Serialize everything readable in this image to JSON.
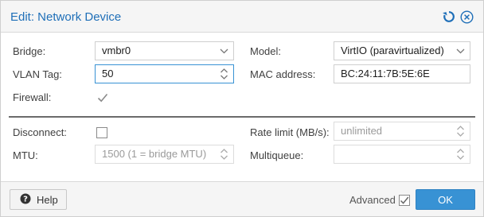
{
  "dialog": {
    "title": "Edit: Network Device",
    "accent_color": "#1f6fb8",
    "tools": {
      "reset_icon": "reset-icon",
      "close_icon": "close-icon"
    }
  },
  "form": {
    "bridge": {
      "label": "Bridge:",
      "value": "vmbr0"
    },
    "vlan_tag": {
      "label": "VLAN Tag:",
      "value": "50"
    },
    "firewall": {
      "label": "Firewall:",
      "checked": true
    },
    "model": {
      "label": "Model:",
      "value": "VirtIO (paravirtualized)"
    },
    "mac_address": {
      "label": "MAC address:",
      "value": "BC:24:11:7B:5E:6E"
    },
    "disconnect": {
      "label": "Disconnect:",
      "checked": false
    },
    "mtu": {
      "label": "MTU:",
      "placeholder": "1500 (1 = bridge MTU)"
    },
    "rate_limit": {
      "label": "Rate limit (MB/s):",
      "placeholder": "unlimited"
    },
    "multiqueue": {
      "label": "Multiqueue:",
      "value": ""
    }
  },
  "footer": {
    "help_label": "Help",
    "advanced_label": "Advanced",
    "advanced_checked": true,
    "ok_label": "OK",
    "ok_color": "#3892d4"
  }
}
